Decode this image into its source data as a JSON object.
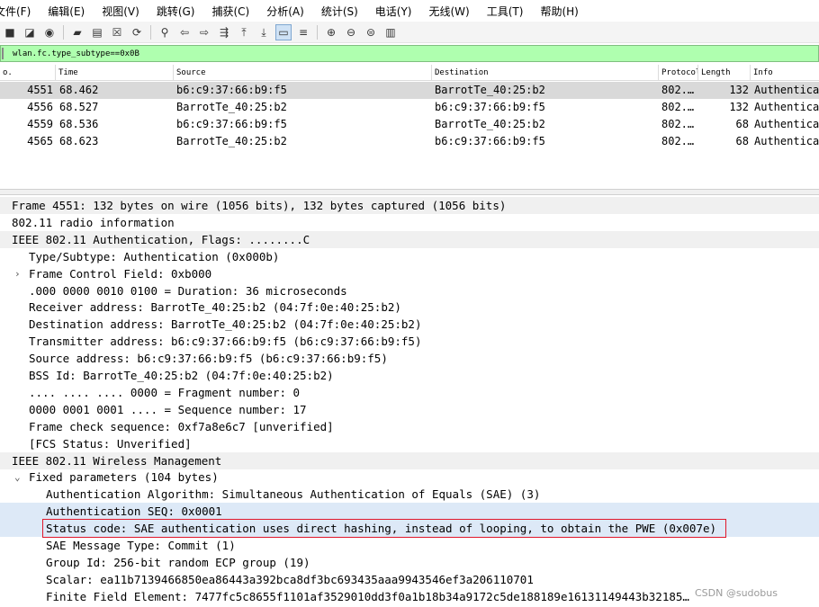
{
  "menu": [
    "文件(F)",
    "编辑(E)",
    "视图(V)",
    "跳转(G)",
    "捕获(C)",
    "分析(A)",
    "统计(S)",
    "电话(Y)",
    "无线(W)",
    "工具(T)",
    "帮助(H)"
  ],
  "toolbar": {
    "icons": [
      "stop-capture-icon",
      "restart-capture-icon",
      "capture-options-icon",
      "open-file-icon",
      "save-file-icon",
      "close-file-icon",
      "reload-icon",
      "find-packet-icon",
      "go-back-icon",
      "go-forward-icon",
      "go-to-packet-icon",
      "first-packet-icon",
      "last-packet-icon",
      "autoscroll-icon",
      "colorize-icon",
      "zoom-in-icon",
      "zoom-out-icon",
      "normal-size-icon",
      "resize-columns-icon"
    ]
  },
  "filter": {
    "value": "wlan.fc.type_subtype==0x0B"
  },
  "columns": [
    "o.",
    "Time",
    "Source",
    "Destination",
    "Protocol",
    "Length",
    "Info"
  ],
  "packets": [
    {
      "no": "4551",
      "time": "68.462",
      "source": "b6:c9:37:66:b9:f5",
      "destination": "BarrotTe_40:25:b2",
      "protocol": "802.…",
      "length": "132",
      "info": "Authentication"
    },
    {
      "no": "4556",
      "time": "68.527",
      "source": "BarrotTe_40:25:b2",
      "destination": "b6:c9:37:66:b9:f5",
      "protocol": "802.…",
      "length": "132",
      "info": "Authentication"
    },
    {
      "no": "4559",
      "time": "68.536",
      "source": "b6:c9:37:66:b9:f5",
      "destination": "BarrotTe_40:25:b2",
      "protocol": "802.…",
      "length": "68",
      "info": "Authentication"
    },
    {
      "no": "4565",
      "time": "68.623",
      "source": "BarrotTe_40:25:b2",
      "destination": "b6:c9:37:66:b9:f5",
      "protocol": "802.…",
      "length": "68",
      "info": "Authentication"
    }
  ],
  "details": [
    {
      "text": "Frame 4551: 132 bytes on wire (1056 bits), 132 bytes captured (1056 bits)",
      "level": 0,
      "header": true
    },
    {
      "text": "802.11 radio information",
      "level": 0,
      "header": false
    },
    {
      "text": "IEEE 802.11 Authentication, Flags: ........C",
      "level": 0,
      "header": true
    },
    {
      "text": "Type/Subtype: Authentication (0x000b)",
      "level": 1,
      "header": false
    },
    {
      "text": "Frame Control Field: 0xb000",
      "level": 1,
      "header": false,
      "arrow": "›"
    },
    {
      "text": ".000 0000 0010 0100 = Duration: 36 microseconds",
      "level": 1,
      "header": false
    },
    {
      "text": "Receiver address: BarrotTe_40:25:b2 (04:7f:0e:40:25:b2)",
      "level": 1,
      "header": false
    },
    {
      "text": "Destination address: BarrotTe_40:25:b2 (04:7f:0e:40:25:b2)",
      "level": 1,
      "header": false
    },
    {
      "text": "Transmitter address: b6:c9:37:66:b9:f5 (b6:c9:37:66:b9:f5)",
      "level": 1,
      "header": false
    },
    {
      "text": "Source address: b6:c9:37:66:b9:f5 (b6:c9:37:66:b9:f5)",
      "level": 1,
      "header": false
    },
    {
      "text": "BSS Id: BarrotTe_40:25:b2 (04:7f:0e:40:25:b2)",
      "level": 1,
      "header": false
    },
    {
      "text": ".... .... .... 0000 = Fragment number: 0",
      "level": 1,
      "header": false
    },
    {
      "text": "0000 0001 0001 .... = Sequence number: 17",
      "level": 1,
      "header": false
    },
    {
      "text": "Frame check sequence: 0xf7a8e6c7 [unverified]",
      "level": 1,
      "header": false
    },
    {
      "text": "[FCS Status: Unverified]",
      "level": 1,
      "header": false
    },
    {
      "text": "IEEE 802.11 Wireless Management",
      "level": 0,
      "header": true
    },
    {
      "text": "Fixed parameters (104 bytes)",
      "level": 1,
      "header": false,
      "arrow": "⌄"
    },
    {
      "text": "Authentication Algorithm: Simultaneous Authentication of Equals (SAE) (3)",
      "level": 2,
      "header": false
    },
    {
      "text": "Authentication SEQ: 0x0001",
      "level": 2,
      "header": false,
      "highlight": true
    },
    {
      "text": "Status code: SAE authentication uses direct hashing, instead of looping, to obtain the PWE (0x007e)",
      "level": 2,
      "header": false,
      "highlight": true
    },
    {
      "text": "SAE Message Type: Commit (1)",
      "level": 2,
      "header": false
    },
    {
      "text": "Group Id: 256-bit random ECP group (19)",
      "level": 2,
      "header": false
    },
    {
      "text": "Scalar: ea11b7139466850ea86443a392bca8df3bc693435aaa9943546ef3a206110701",
      "level": 2,
      "header": false
    },
    {
      "text": "Finite Field Element: 7477fc5c8655f1101af3529010dd3f0a1b18b34a9172c5de188189e16131149443b32185…",
      "level": 2,
      "header": false
    }
  ],
  "watermark": "CSDN @sudobus"
}
